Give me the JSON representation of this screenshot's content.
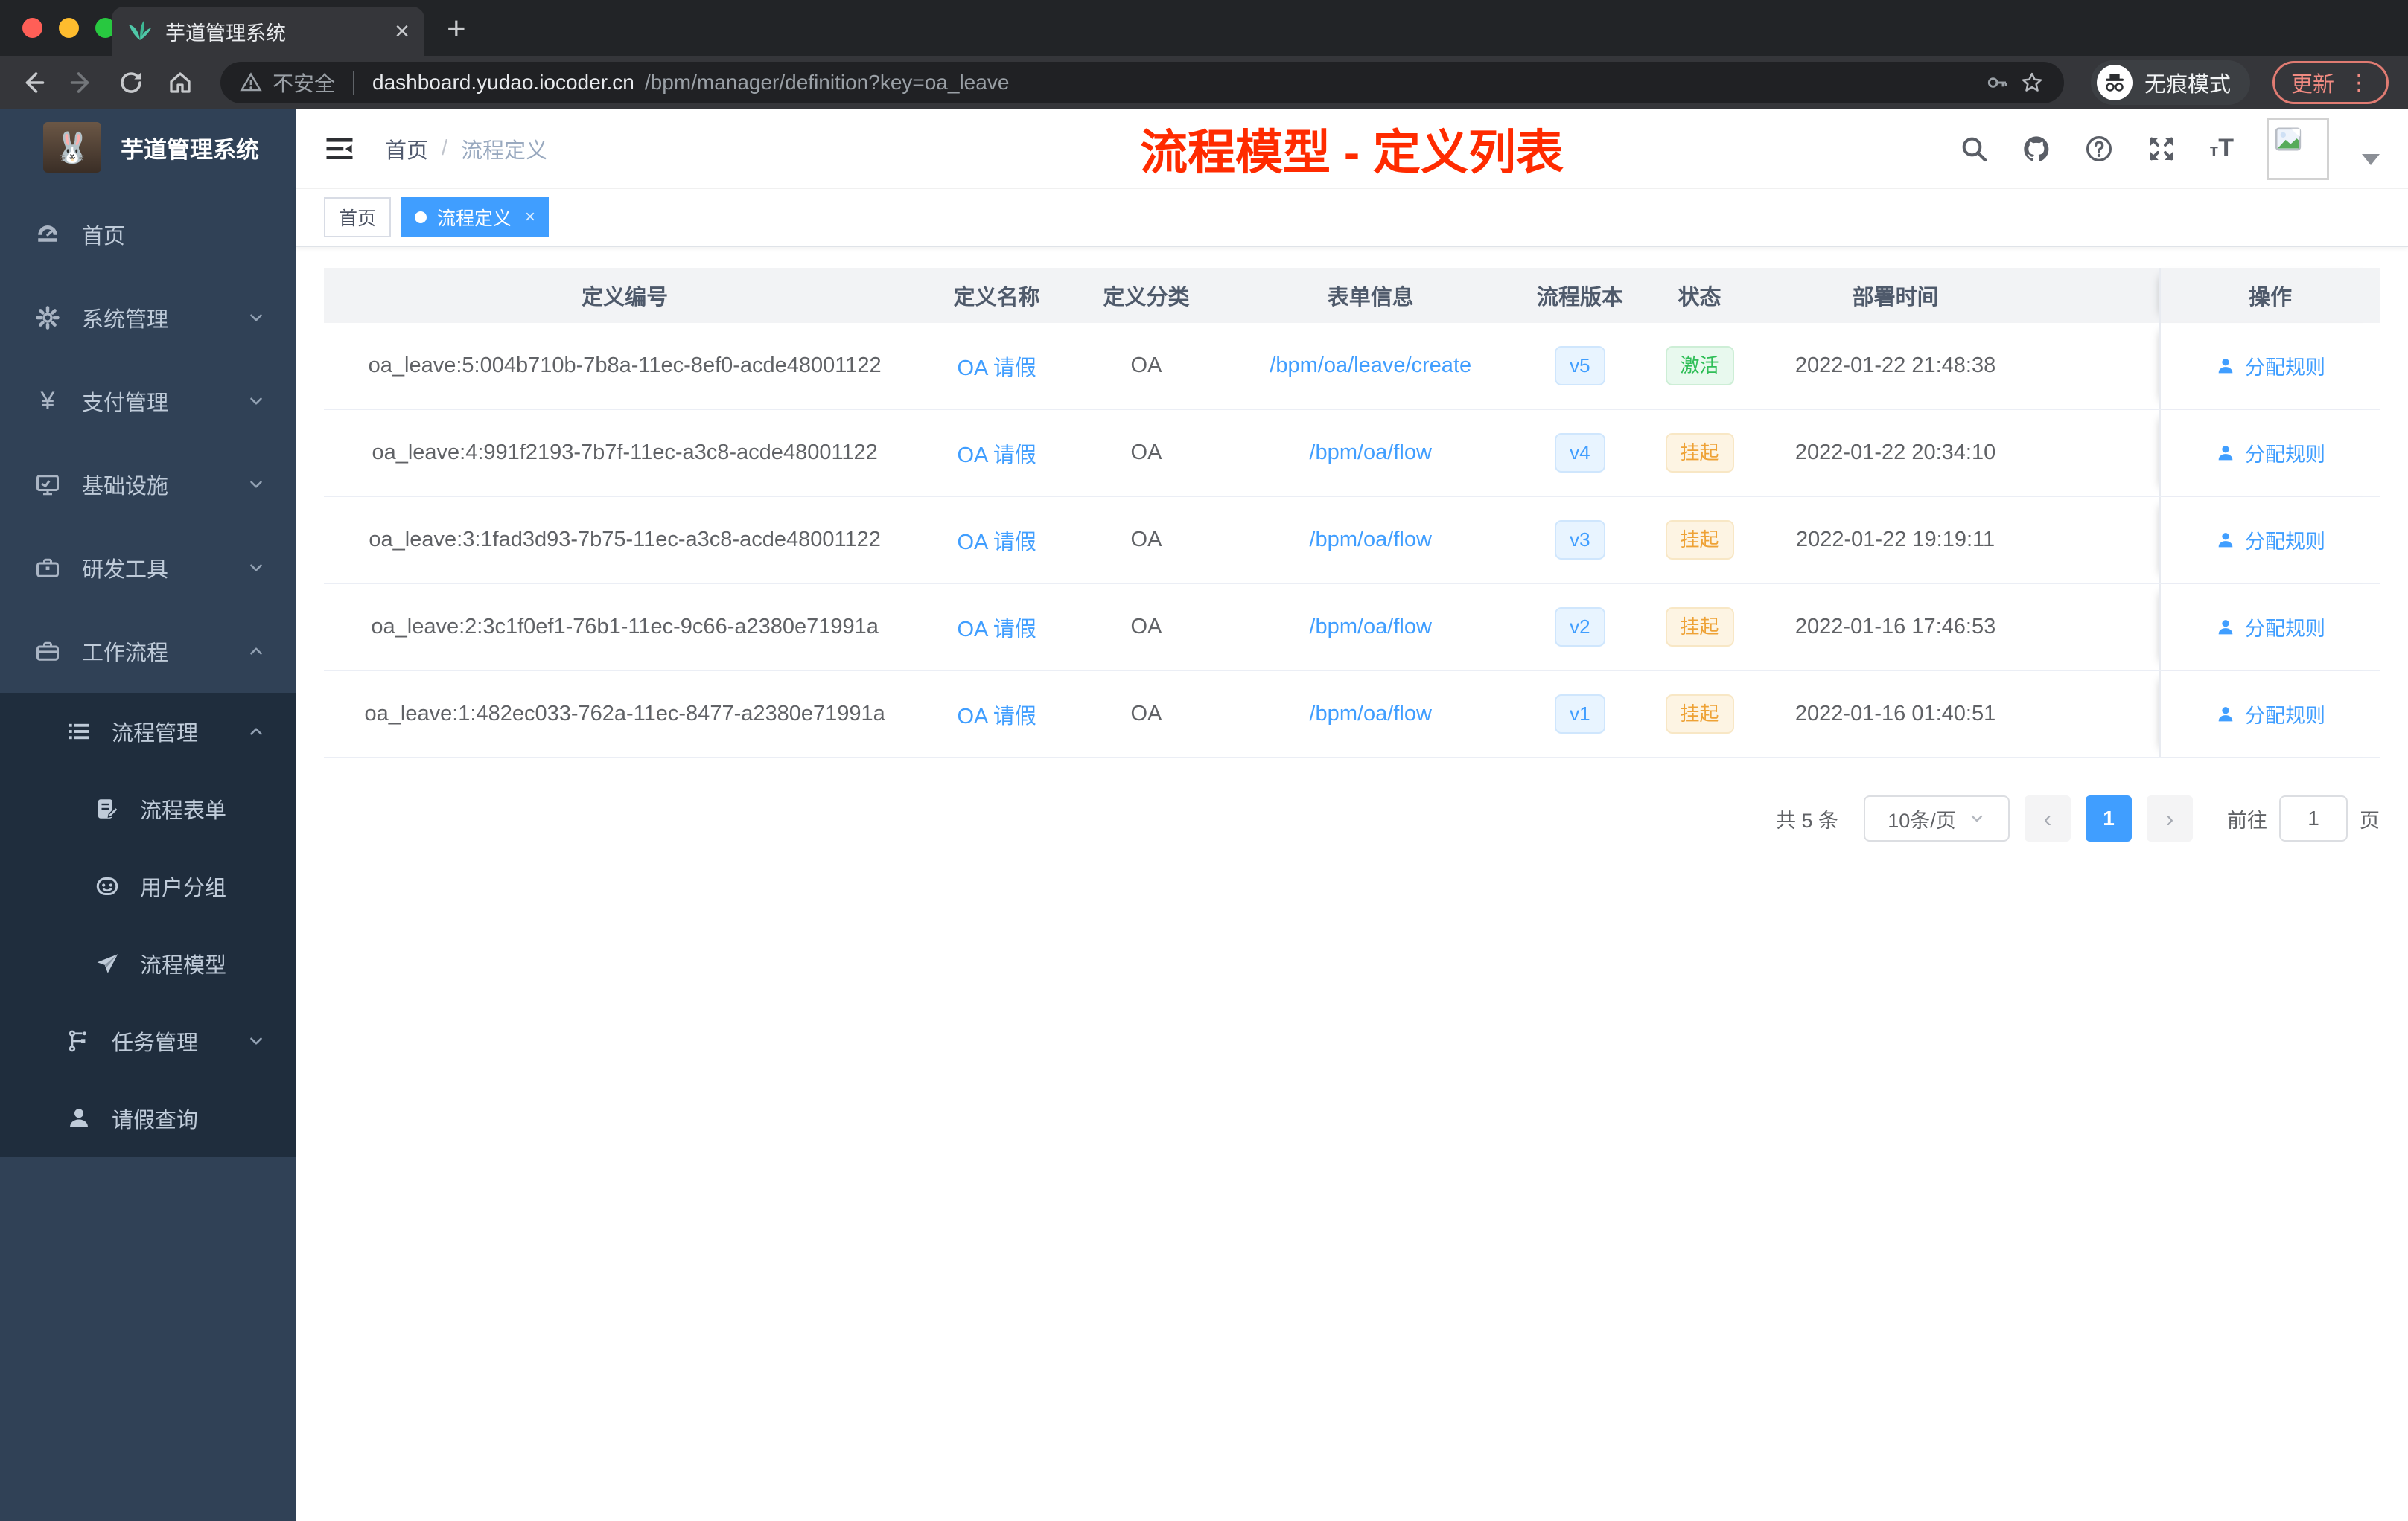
{
  "browser": {
    "tab_title": "芋道管理系统",
    "tab_close": "×",
    "new_tab": "+",
    "security_label": "不安全",
    "url_domain": "dashboard.yudao.iocoder.cn",
    "url_path": "/bpm/manager/definition?key=oa_leave",
    "incognito_label": "无痕模式",
    "update_label": "更新",
    "update_dots": "⋮"
  },
  "sidebar": {
    "logo_title": "芋道管理系统",
    "items": [
      {
        "label": "首页"
      },
      {
        "label": "系统管理"
      },
      {
        "label": "支付管理"
      },
      {
        "label": "基础设施"
      },
      {
        "label": "研发工具"
      },
      {
        "label": "工作流程"
      }
    ],
    "workflow_children": [
      {
        "label": "流程管理"
      },
      {
        "label": "流程表单"
      },
      {
        "label": "用户分组"
      },
      {
        "label": "流程模型"
      },
      {
        "label": "任务管理"
      },
      {
        "label": "请假查询"
      }
    ]
  },
  "navbar": {
    "breadcrumb_home": "首页",
    "breadcrumb_sep": "/",
    "breadcrumb_current": "流程定义",
    "annotation": "流程模型 - 定义列表"
  },
  "tags": {
    "home": "首页",
    "active": "流程定义",
    "close": "×"
  },
  "table": {
    "headers": {
      "id": "定义编号",
      "name": "定义名称",
      "category": "定义分类",
      "form": "表单信息",
      "version": "流程版本",
      "status": "状态",
      "deploy_time": "部署时间",
      "action": "操作"
    },
    "action_label": "分配规则",
    "rows": [
      {
        "id": "oa_leave:5:004b710b-7b8a-11ec-8ef0-acde48001122",
        "name": "OA 请假",
        "category": "OA",
        "form": "/bpm/oa/leave/create",
        "version": "v5",
        "status": "激活",
        "status_type": "active",
        "deploy_time": "2022-01-22 21:48:38"
      },
      {
        "id": "oa_leave:4:991f2193-7b7f-11ec-a3c8-acde48001122",
        "name": "OA 请假",
        "category": "OA",
        "form": "/bpm/oa/flow",
        "version": "v4",
        "status": "挂起",
        "status_type": "suspended",
        "deploy_time": "2022-01-22 20:34:10"
      },
      {
        "id": "oa_leave:3:1fad3d93-7b75-11ec-a3c8-acde48001122",
        "name": "OA 请假",
        "category": "OA",
        "form": "/bpm/oa/flow",
        "version": "v3",
        "status": "挂起",
        "status_type": "suspended",
        "deploy_time": "2022-01-22 19:19:11"
      },
      {
        "id": "oa_leave:2:3c1f0ef1-76b1-11ec-9c66-a2380e71991a",
        "name": "OA 请假",
        "category": "OA",
        "form": "/bpm/oa/flow",
        "version": "v2",
        "status": "挂起",
        "status_type": "suspended",
        "deploy_time": "2022-01-16 17:46:53"
      },
      {
        "id": "oa_leave:1:482ec033-762a-11ec-8477-a2380e71991a",
        "name": "OA 请假",
        "category": "OA",
        "form": "/bpm/oa/flow",
        "version": "v1",
        "status": "挂起",
        "status_type": "suspended",
        "deploy_time": "2022-01-16 01:40:51"
      }
    ]
  },
  "pagination": {
    "total": "共 5 条",
    "page_size": "10条/页",
    "prev": "‹",
    "page": "1",
    "next": "›",
    "goto_label": "前往",
    "goto_value": "1",
    "unit": "页"
  },
  "colors": {
    "accent": "#409eff",
    "sidebar_bg": "#304156",
    "submenu_bg": "#1f2d3d",
    "annotation_red": "#ff2b00",
    "success_text": "#2fbe57",
    "warning_text": "#eea236",
    "version_text": "#409eff"
  }
}
